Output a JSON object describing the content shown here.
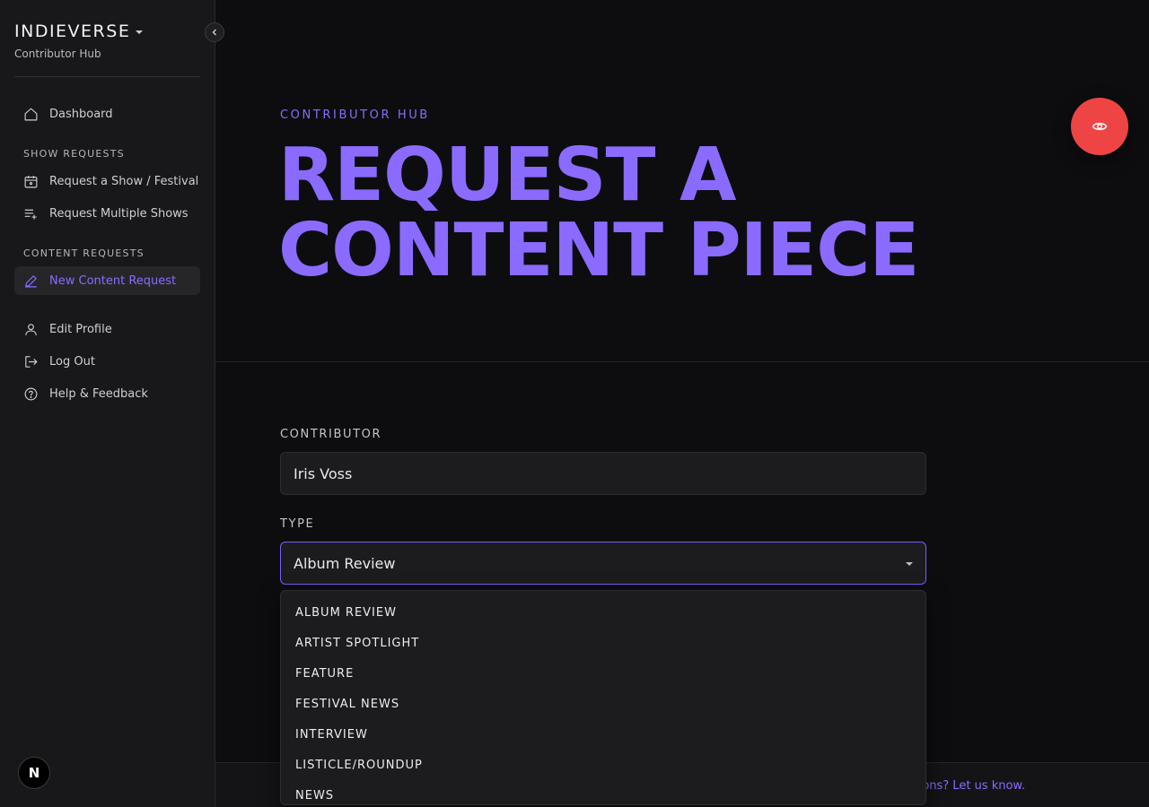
{
  "sidebar": {
    "brand": "INDIEVERSE",
    "subtitle": "Contributor Hub",
    "dashboard": "Dashboard",
    "section_show": "SHOW REQUESTS",
    "request_show": "Request a Show / Festival",
    "request_multiple": "Request Multiple Shows",
    "section_content": "CONTENT REQUESTS",
    "new_content": "New Content Request",
    "edit_profile": "Edit Profile",
    "log_out": "Log Out",
    "help": "Help & Feedback",
    "badge": "N"
  },
  "hero": {
    "eyebrow": "CONTRIBUTOR HUB",
    "title_line1": "REQUEST A",
    "title_line2": "CONTENT PIECE"
  },
  "form": {
    "contributor_label": "CONTRIBUTOR",
    "contributor_value": "Iris Voss",
    "type_label": "TYPE",
    "type_value": "Album Review",
    "type_options": [
      "ALBUM REVIEW",
      "ARTIST SPOTLIGHT",
      "FEATURE",
      "FESTIVAL NEWS",
      "INTERVIEW",
      "LISTICLE/ROUNDUP",
      "NEWS"
    ]
  },
  "footer": {
    "link_text": "ons? Let us know."
  },
  "colors": {
    "accent": "#8b6bff",
    "fab": "#ef4444",
    "sidebar_bg": "#18181a",
    "main_bg": "#0d0d0f"
  },
  "icons": {
    "fab": "eye-icon",
    "collapse": "chevron-left-icon"
  }
}
